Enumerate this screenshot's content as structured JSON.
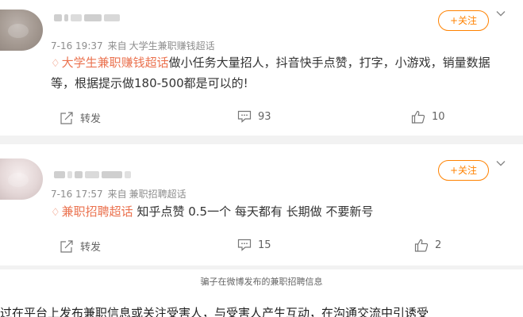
{
  "colors": {
    "accent": "#ff8200",
    "topic": "#eb7350",
    "meta": "#8d8d8d",
    "page_bg": "#f2f2f2"
  },
  "posts": [
    {
      "username": "██ █████",
      "time": "7-16 19:37",
      "source_prefix": "来自",
      "source": "大学生兼职赚钱超话",
      "follow_label": "+关注",
      "topic_icon": "topic-diamond-icon",
      "topic": "大学生兼职赚钱超话",
      "body": "做小任务大量招人，抖音快手点赞，打字，小游戏，销量数据等，根据提示做180-500都是可以的!",
      "repost_label": "转发",
      "comment_count": "93",
      "like_count": "10"
    },
    {
      "username": "███ ████",
      "time": "7-16 17:57",
      "source_prefix": "来自",
      "source": "兼职招聘超话",
      "follow_label": "+关注",
      "topic_icon": "topic-diamond-icon",
      "topic": "兼职招聘超话",
      "body": " 知乎点赞 0.5一个 每天都有 长期做 不要新号",
      "repost_label": "转发",
      "comment_count": "15",
      "like_count": "2"
    }
  ],
  "caption": "骗子在微博发布的兼职招聘信息",
  "bottom_text": "过在平台上发布兼职信息或关注受害人，与受害人产生互动，在沟通交流中引诱受"
}
